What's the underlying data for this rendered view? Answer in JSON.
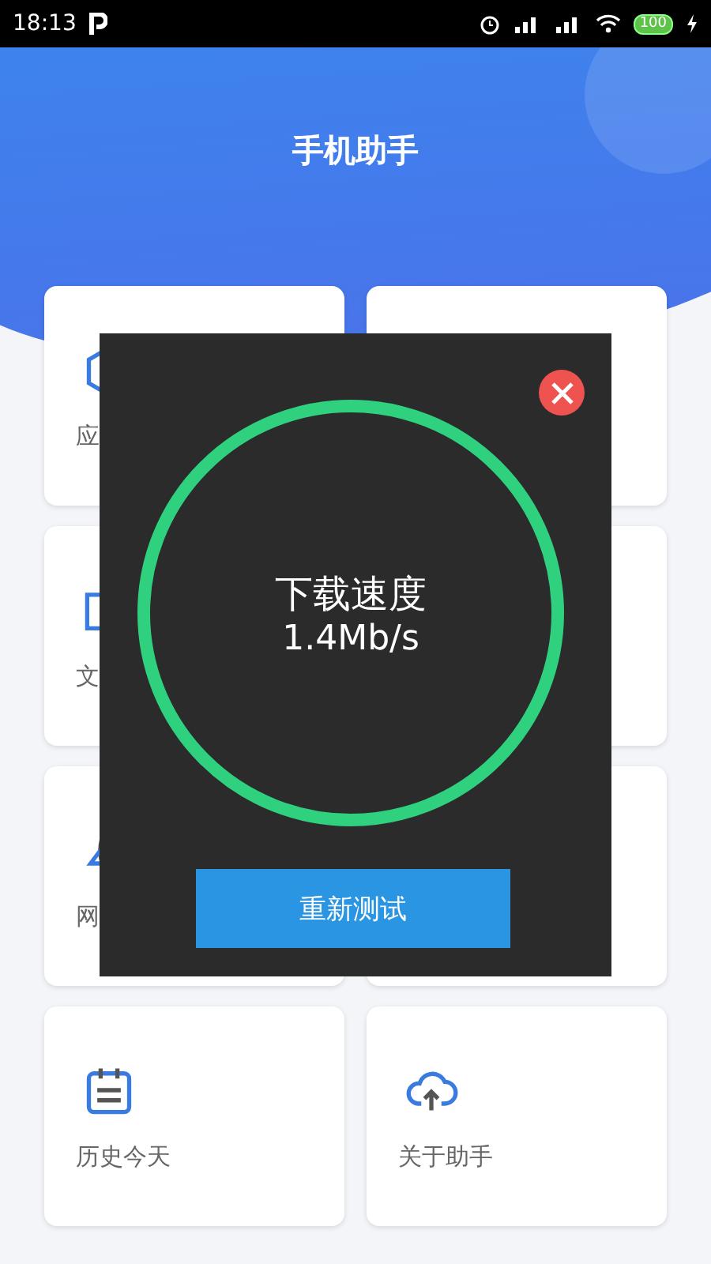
{
  "status_bar": {
    "time": "18:13",
    "battery": "100"
  },
  "header": {
    "title": "手机助手"
  },
  "cards": [
    {
      "label": "应",
      "kind": "hexagon"
    },
    {
      "kind": "blank"
    },
    {
      "label": "文",
      "kind": "folder"
    },
    {
      "kind": "blank"
    },
    {
      "label": "网",
      "kind": "rocket"
    },
    {
      "kind": "blank"
    },
    {
      "label": "历史今天",
      "kind": "calendar"
    },
    {
      "label": "关于助手",
      "kind": "cloud"
    }
  ],
  "dialog": {
    "title": "下载速度",
    "value": "1.4Mb/s",
    "button": "重新测试"
  }
}
